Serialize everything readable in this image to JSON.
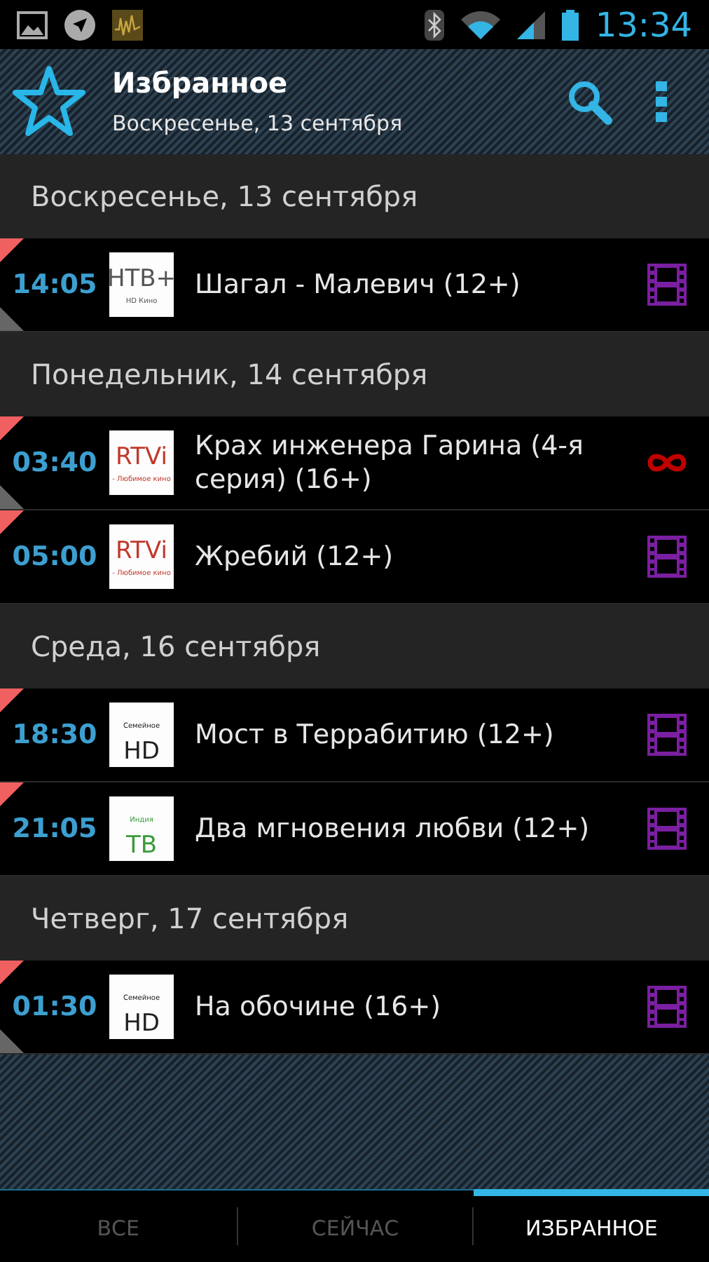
{
  "status_bar": {
    "time": "13:34"
  },
  "header": {
    "title": "Избранное",
    "subtitle": "Воскресенье, 13 сентября"
  },
  "sections": [
    {
      "date": "Воскресенье, 13 сентября",
      "programs": [
        {
          "time": "14:05",
          "logo": {
            "kind": "big_top",
            "top": "НТВ+",
            "bottom": "HD Кино",
            "color": "#555555"
          },
          "title": "Шагал - Малевич (12+)",
          "flag_top": true,
          "flag_bottom": true,
          "kind": "film"
        }
      ]
    },
    {
      "date": "Понедельник, 14 сентября",
      "programs": [
        {
          "time": "03:40",
          "logo": {
            "kind": "big_top",
            "top": "RTVi",
            "bottom": "- Любимое кино",
            "color": "#c0392b"
          },
          "title": "Крах инженера Гарина (4-я серия) (16+)",
          "flag_top": true,
          "flag_bottom": true,
          "kind": "series"
        },
        {
          "time": "05:00",
          "logo": {
            "kind": "big_top",
            "top": "RTVi",
            "bottom": "- Любимое кино",
            "color": "#c0392b"
          },
          "title": "Жребий (12+)",
          "flag_top": true,
          "flag_bottom": false,
          "kind": "film"
        }
      ]
    },
    {
      "date": "Среда, 16 сентября",
      "programs": [
        {
          "time": "18:30",
          "logo": {
            "kind": "big_bottom",
            "top": "Семейное",
            "bottom": "HD",
            "color": "#222222"
          },
          "title": "Мост в Террабитию (12+)",
          "flag_top": true,
          "flag_bottom": false,
          "kind": "film"
        },
        {
          "time": "21:05",
          "logo": {
            "kind": "big_bottom",
            "top": "Индия",
            "bottom": "ТВ",
            "color": "#3a9a3a"
          },
          "title": "Два мгновения любви (12+)",
          "flag_top": true,
          "flag_bottom": false,
          "kind": "film"
        }
      ]
    },
    {
      "date": "Четверг, 17 сентября",
      "programs": [
        {
          "time": "01:30",
          "logo": {
            "kind": "big_bottom",
            "top": "Семейное",
            "bottom": "HD",
            "color": "#222222"
          },
          "title": "На обочине (16+)",
          "flag_top": true,
          "flag_bottom": true,
          "kind": "film"
        }
      ]
    }
  ],
  "tabs": [
    {
      "label": "ВСЕ",
      "selected": false
    },
    {
      "label": "СЕЙЧАС",
      "selected": false
    },
    {
      "label": "ИЗБРАННОЕ",
      "selected": true
    }
  ]
}
